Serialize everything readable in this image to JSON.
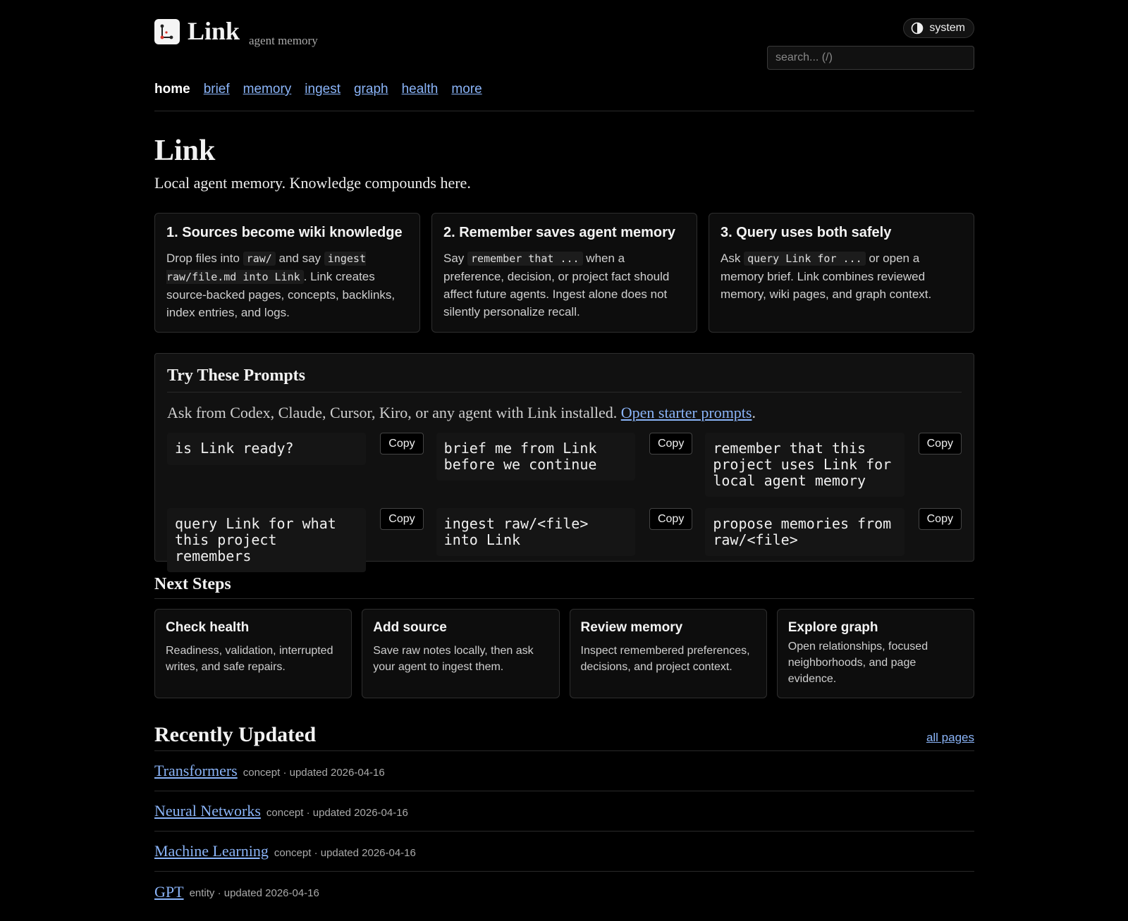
{
  "header": {
    "brand": "Link",
    "tagline": "agent memory",
    "theme_label": "system",
    "search_placeholder": "search... (/)"
  },
  "nav": [
    {
      "label": "home",
      "active": true
    },
    {
      "label": "brief"
    },
    {
      "label": "memory"
    },
    {
      "label": "ingest"
    },
    {
      "label": "graph"
    },
    {
      "label": "health"
    },
    {
      "label": "more"
    }
  ],
  "hero": {
    "title": "Link",
    "subtitle": "Local agent memory. Knowledge compounds here."
  },
  "cards": [
    {
      "title": "1. Sources become wiki knowledge",
      "t1": "Drop files into ",
      "c1": "raw/",
      "t2": " and say ",
      "c2": "ingest raw/file.md into Link",
      "t3": ". Link creates source-backed pages, concepts, backlinks, index entries, and logs."
    },
    {
      "title": "2. Remember saves agent memory",
      "t1": "Say ",
      "c1": "remember that ...",
      "t2": " when a preference, decision, or project fact should affect future agents. Ingest alone does not silently personalize recall."
    },
    {
      "title": "3. Query uses both safely",
      "t1": "Ask ",
      "c1": "query Link for ...",
      "t2": " or open a memory brief. Link combines reviewed memory, wiki pages, and graph context."
    }
  ],
  "prompts": {
    "title": "Try These Prompts",
    "intro": "Ask from Codex, Claude, Cursor, Kiro, or any agent with Link installed. ",
    "intro_link": "Open starter prompts",
    "intro_end": ".",
    "copy_label": "Copy",
    "items": [
      "is Link ready?",
      "brief me from Link before we continue",
      "remember that this project uses Link for local agent memory",
      "query Link for what this project remembers",
      "ingest raw/<file> into Link",
      "propose memories from raw/<file>"
    ]
  },
  "next_steps": {
    "title": "Next Steps",
    "items": [
      {
        "title": "Check health",
        "desc": "Readiness, validation, interrupted writes, and safe repairs."
      },
      {
        "title": "Add source",
        "desc": "Save raw notes locally, then ask your agent to ingest them."
      },
      {
        "title": "Review memory",
        "desc": "Inspect remembered preferences, decisions, and project context."
      },
      {
        "title": "Explore graph",
        "desc": "Open relationships, focused neighborhoods, and page evidence."
      }
    ]
  },
  "recent": {
    "title": "Recently Updated",
    "all_pages": "all pages",
    "items": [
      {
        "title": "Transformers",
        "meta": "concept · updated 2026-04-16"
      },
      {
        "title": "Neural Networks",
        "meta": "concept · updated 2026-04-16"
      },
      {
        "title": "Machine Learning",
        "meta": "concept · updated 2026-04-16"
      },
      {
        "title": "GPT",
        "meta": "entity · updated 2026-04-16"
      }
    ]
  },
  "colors": {
    "background": "#000000",
    "link": "#8ab4f8",
    "text": "#e8e8e8"
  }
}
